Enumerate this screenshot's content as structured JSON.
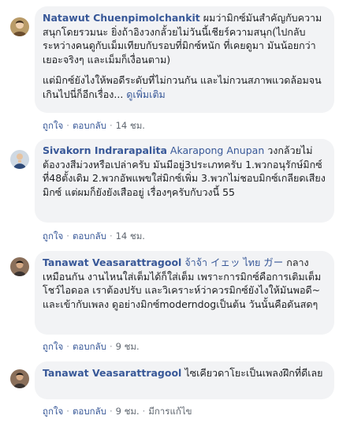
{
  "comments": [
    {
      "author": "Natawut Chuenpimolchankit",
      "tagged": "",
      "text_lead": " ผมว่ามิกซ์มันสำคัญกับความสนุกโดยรวมนะ ยิ่งถ้าอิงวงกลั้วยไม่วันนี้เชียร์ความสนุก(ไปกลับระหว่างคนดูกับเม็มเทียบกับรอบที่มิกซ์หนัก ที่เคยดูมา มันน้อยกว่าเยอะจริงๆ และเม็มก็เงื่อนตาม)",
      "text2": "แต่มิกซ์ยังไงให้พอดีระดับที่ไม่กวนกัน และไม่กวนสภาพแวดล้อมจนเกินไปนี่ก็อีกเรื่อง... ",
      "see_more": "ดูเพิ่มเติม",
      "like": "ถูกใจ",
      "reply": "ตอบกลับ",
      "time": "14 ชม.",
      "edited": ""
    },
    {
      "author": "Sivakorn Indrarapalita",
      "tagged": " Akarapong Anupan",
      "text_lead": " วงกล้วยไม่ต้องวงสีม่วงหรือเปล่าครับ มันมีอยู่3ประเภทครับ 1.พวกอนุรักษ์มิกซ์ที่48ตั้งเดิม 2.พวกอัพแพขใส่มิกซ์เพิ่ม 3.พวกไม่ชอบมิกซ์เกลียดเสียงมิกซ์ แต่ผมก็ยังยังเสืออยู่ เรื่องๆครับกับวงนี้ 55",
      "text2": "",
      "see_more": "",
      "like": "ถูกใจ",
      "reply": "ตอบกลับ",
      "time": "14 ชม.",
      "edited": ""
    },
    {
      "author": "Tanawat Veasarattragool",
      "tagged": " จ้าจ้า イェッ ไทย ガー",
      "text_lead": " กลางเหมือนกัน งานไหนใส่เต็มได้ก็ใส่เต็ม เพราะการมิกซ์คือการเติมเต็มโชว์ไอดอล เราต้องปรับ และวิเคราะห์ว่าควรมิกซ์ยังไงให้มันพอดี~ และเข้ากับเพลง ดูอย่างมิกซ์moderndogเป็นต้น วันนั้นคือดันสดๆ",
      "text2": "",
      "see_more": "",
      "like": "ถูกใจ",
      "reply": "ตอบกลับ",
      "time": "9 ชม.",
      "edited": ""
    },
    {
      "author": "Tanawat Veasarattragool",
      "tagged": "",
      "text_lead": " ไซเคียวดาโยะเป็นเพลงฝึกที่ดีเลย",
      "text2": "",
      "see_more": "",
      "like": "ถูกใจ",
      "reply": "ตอบกลับ",
      "time": "9 ชม.",
      "edited": "มีการแก้ไข"
    }
  ]
}
